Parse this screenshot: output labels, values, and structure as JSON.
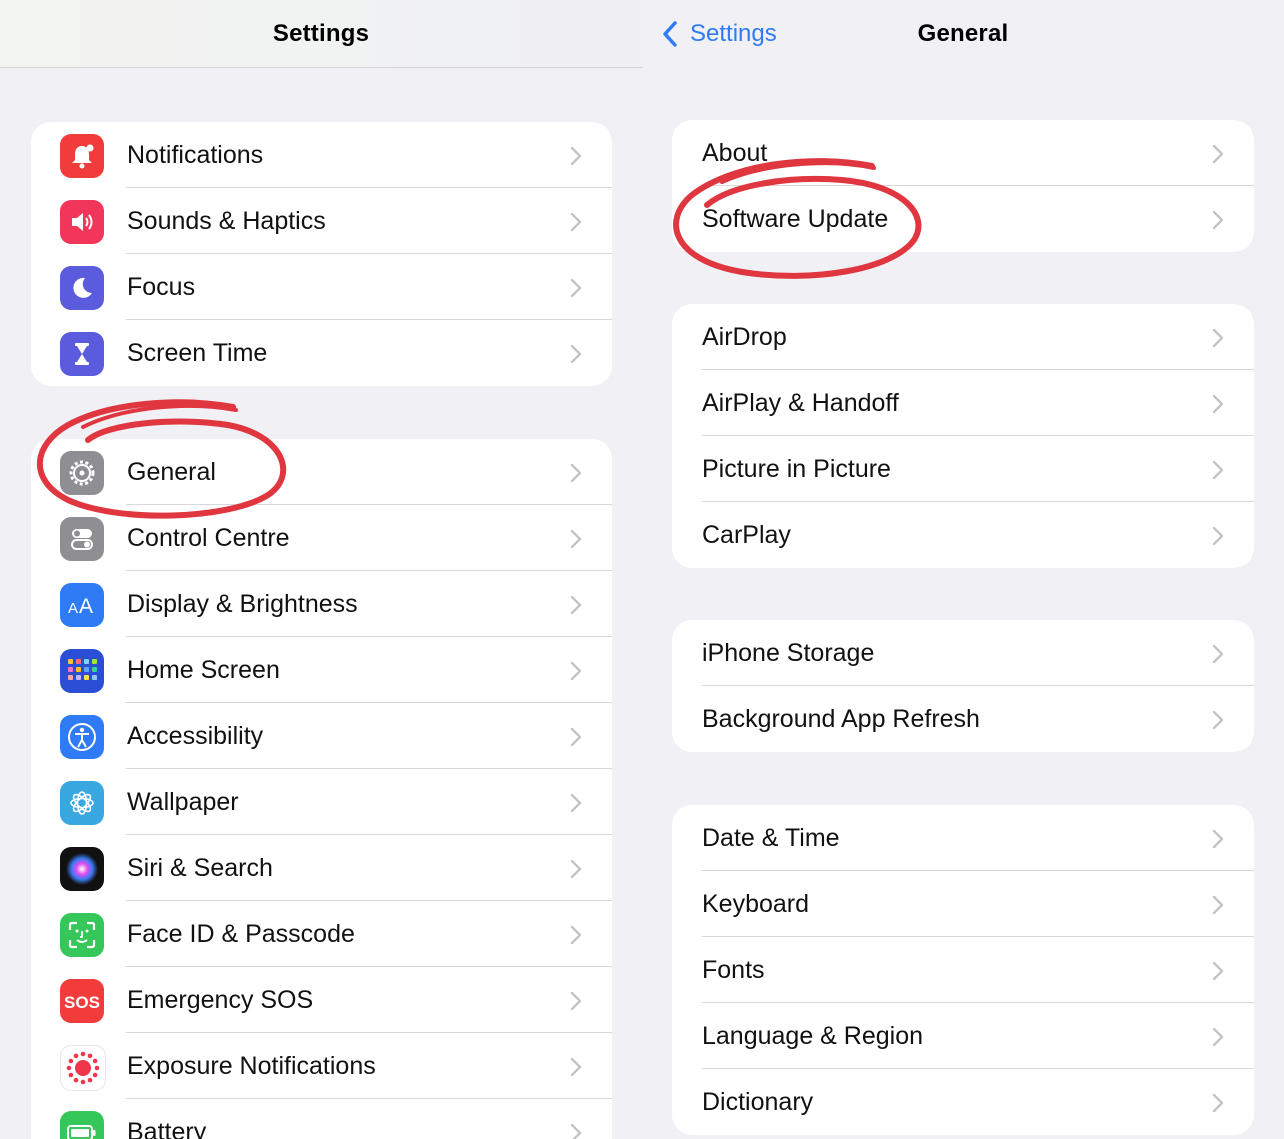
{
  "left": {
    "title": "Settings",
    "groups": [
      [
        {
          "label": "Notifications",
          "icon": "bell-icon",
          "color": "#f23b3b"
        },
        {
          "label": "Sounds & Haptics",
          "icon": "speaker-icon",
          "color": "#f2365a"
        },
        {
          "label": "Focus",
          "icon": "moon-icon",
          "color": "#5b5bde"
        },
        {
          "label": "Screen Time",
          "icon": "hourglass-icon",
          "color": "#5b5bde"
        }
      ],
      [
        {
          "label": "General",
          "icon": "gear-icon",
          "color": "#8e8e93"
        },
        {
          "label": "Control Centre",
          "icon": "toggles-icon",
          "color": "#8e8e93"
        },
        {
          "label": "Display & Brightness",
          "icon": "text-size-icon",
          "color": "#2f7bf5"
        },
        {
          "label": "Home Screen",
          "icon": "app-grid-icon",
          "color": "#2a4fd6"
        },
        {
          "label": "Accessibility",
          "icon": "accessibility-icon",
          "color": "#2f7bf5"
        },
        {
          "label": "Wallpaper",
          "icon": "flower-icon",
          "color": "#39a8e0"
        },
        {
          "label": "Siri & Search",
          "icon": "siri-icon",
          "color": "#111111"
        },
        {
          "label": "Face ID & Passcode",
          "icon": "face-id-icon",
          "color": "#35c759"
        },
        {
          "label": "Emergency SOS",
          "icon": "sos-icon",
          "color": "#f23b3b"
        },
        {
          "label": "Exposure Notifications",
          "icon": "exposure-icon",
          "color": "#ffffff"
        },
        {
          "label": "Battery",
          "icon": "battery-icon",
          "color": "#35c759"
        }
      ]
    ]
  },
  "right": {
    "back_label": "Settings",
    "title": "General",
    "groups": [
      [
        {
          "label": "About"
        },
        {
          "label": "Software Update"
        }
      ],
      [
        {
          "label": "AirDrop"
        },
        {
          "label": "AirPlay & Handoff"
        },
        {
          "label": "Picture in Picture"
        },
        {
          "label": "CarPlay"
        }
      ],
      [
        {
          "label": "iPhone Storage"
        },
        {
          "label": "Background App Refresh"
        }
      ],
      [
        {
          "label": "Date & Time"
        },
        {
          "label": "Keyboard"
        },
        {
          "label": "Fonts"
        },
        {
          "label": "Language & Region"
        },
        {
          "label": "Dictionary"
        }
      ]
    ]
  },
  "annotation_color": "#e0363f"
}
